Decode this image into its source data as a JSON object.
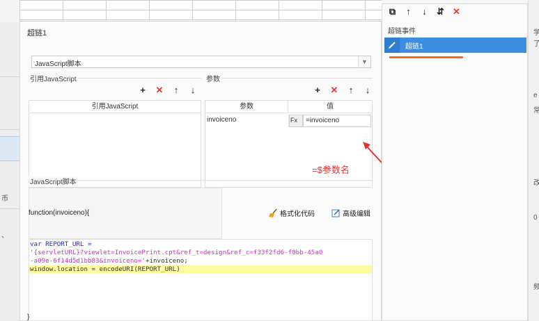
{
  "dialog": {
    "title": "超链1"
  },
  "type_select": {
    "value": "JavaScript脚本"
  },
  "ref_section": {
    "label": "引用JavaScript",
    "column_header": "引用JavaScript"
  },
  "param_section": {
    "label": "参数",
    "col_name": "参数",
    "col_value": "值",
    "rows": [
      {
        "name": "invoiceno",
        "type": "Fx",
        "value": "=invoiceno"
      }
    ]
  },
  "annotation": {
    "text": "=$参数名",
    "color": "#e33333"
  },
  "script_section": {
    "label": "JavaScript脚本",
    "function_sig": "function(invoiceno){",
    "format_label": "格式化代码",
    "advanced_edit_label": "高级编辑",
    "closing_brace": "}"
  },
  "code": {
    "line1_kw": "var",
    "line1_rest": " REPORT_URL =",
    "line2": "'{servletURL}?viewlet=InvoicePrint.cpt&ref_t=design&ref_c=f33f2fd6-f0bb-45a0",
    "line3_str": "-a09e-6f14d5d1bb83&invoiceno='",
    "line3_rest": "+invoiceno;",
    "line4": "window.location = encodeURI(REPORT_URL)"
  },
  "right_panel": {
    "header": "超链事件",
    "item_label": "超链1",
    "accent": "#3d8de0",
    "underline_color": "#f26b25"
  },
  "background": {
    "left_texts": [
      "币",
      "、"
    ],
    "right_texts": [
      "学",
      "了",
      "e",
      "常",
      "改",
      "0",
      "频"
    ]
  },
  "icons": {
    "add": "+",
    "remove": "✕",
    "up": "↑",
    "down": "↓",
    "copy": "⧉",
    "sort": "⇵"
  }
}
